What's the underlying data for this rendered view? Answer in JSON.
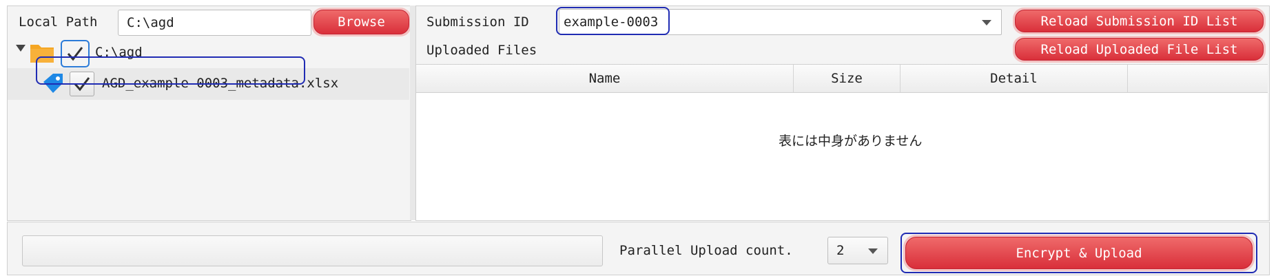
{
  "local_path": {
    "label": "Local Path",
    "value": "C:\\agd",
    "browse_label": "Browse"
  },
  "tree": {
    "root": {
      "label": "C:\\agd",
      "checked": true
    },
    "items": [
      {
        "label": "AGD_example-0003_metadata.xlsx",
        "checked": true
      }
    ]
  },
  "submission": {
    "label": "Submission ID",
    "selected": "example-0003",
    "reload_ids_label": "Reload Submission ID List"
  },
  "uploaded": {
    "label": "Uploaded Files",
    "reload_files_label": "Reload Uploaded File List",
    "columns": [
      "Name",
      "Size",
      "Detail"
    ],
    "empty_text": "表には中身がありません"
  },
  "footer": {
    "progress": 0,
    "parallel_label": "Parallel Upload count.",
    "parallel_value": "2",
    "upload_label": "Encrypt & Upload"
  },
  "colors": {
    "accent": "#d92f3a",
    "highlight": "#1f2bb3",
    "folder": "#f5a623",
    "tag": "#1e88e5"
  }
}
